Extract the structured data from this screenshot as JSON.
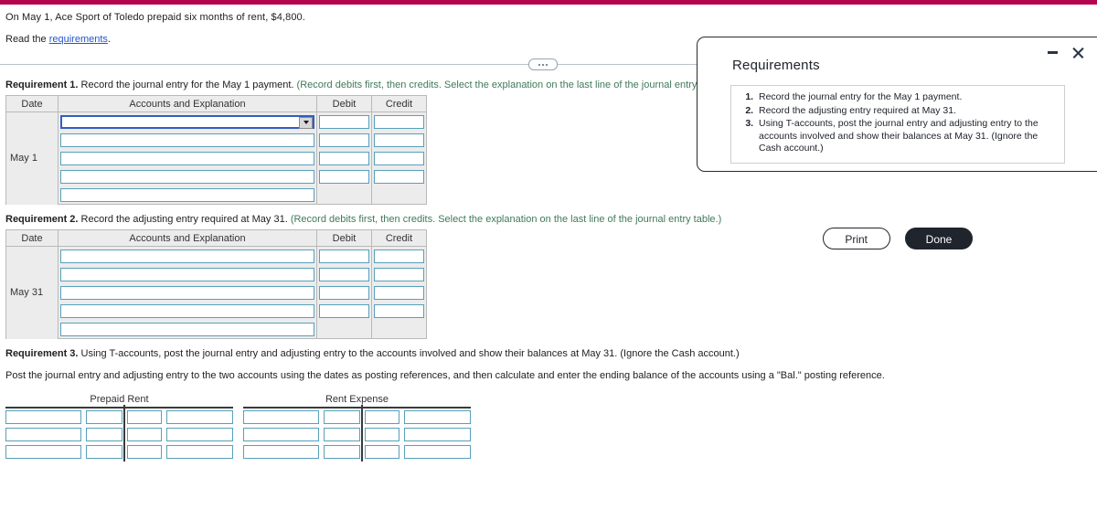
{
  "brand": {
    "bar_color": "#b4044f"
  },
  "problem": {
    "statement": "On May 1, Ace Sport of Toledo prepaid six months of rent, $4,800.",
    "read_prefix": "Read the ",
    "read_link": "requirements",
    "read_suffix": "."
  },
  "divider": {
    "handle_icon": "ellipsis-handle"
  },
  "requirements": [
    {
      "label": "Requirement 1.",
      "text": " Record the journal entry for the May 1 payment. ",
      "hint": "(Record debits first, then credits. Select the explanation on the last line of the journal entry table.)",
      "table": {
        "columns": [
          "Date",
          "Accounts and Explanation",
          "Debit",
          "Credit"
        ],
        "date_value": "May 1",
        "rows": 5,
        "rows_with_amounts": 4,
        "first_row_is_dropdown": true
      }
    },
    {
      "label": "Requirement 2.",
      "text": " Record the adjusting entry required at May 31. ",
      "hint": "(Record debits first, then credits. Select the explanation on the last line of the journal entry table.)",
      "table": {
        "columns": [
          "Date",
          "Accounts and Explanation",
          "Debit",
          "Credit"
        ],
        "date_value": "May 31",
        "rows": 5,
        "rows_with_amounts": 4,
        "first_row_is_dropdown": false
      }
    }
  ],
  "requirement3": {
    "label": "Requirement 3.",
    "text": " Using T-accounts, post the journal entry and adjusting entry to the accounts involved and show their balances at May 31. (Ignore the Cash account.)",
    "instruction": "Post the journal entry and adjusting entry to the two accounts using the dates as posting references, and then calculate and enter the ending balance of the accounts using a \"Bal.\" posting reference.",
    "t_accounts": [
      {
        "title": "Prepaid Rent",
        "rows": 3,
        "cells_per_row": 4
      },
      {
        "title": "Rent Expense",
        "rows": 3,
        "cells_per_row": 4
      }
    ]
  },
  "modal": {
    "title": "Requirements",
    "minimize_icon": "minimize-icon",
    "close_icon": "close-icon",
    "items": [
      "Record the journal entry for the May 1 payment.",
      "Record the adjusting entry required at May 31.",
      "Using T-accounts, post the journal entry and adjusting entry to the accounts involved and show their balances at May 31. (Ignore the Cash account.)"
    ],
    "print_label": "Print",
    "done_label": "Done"
  }
}
